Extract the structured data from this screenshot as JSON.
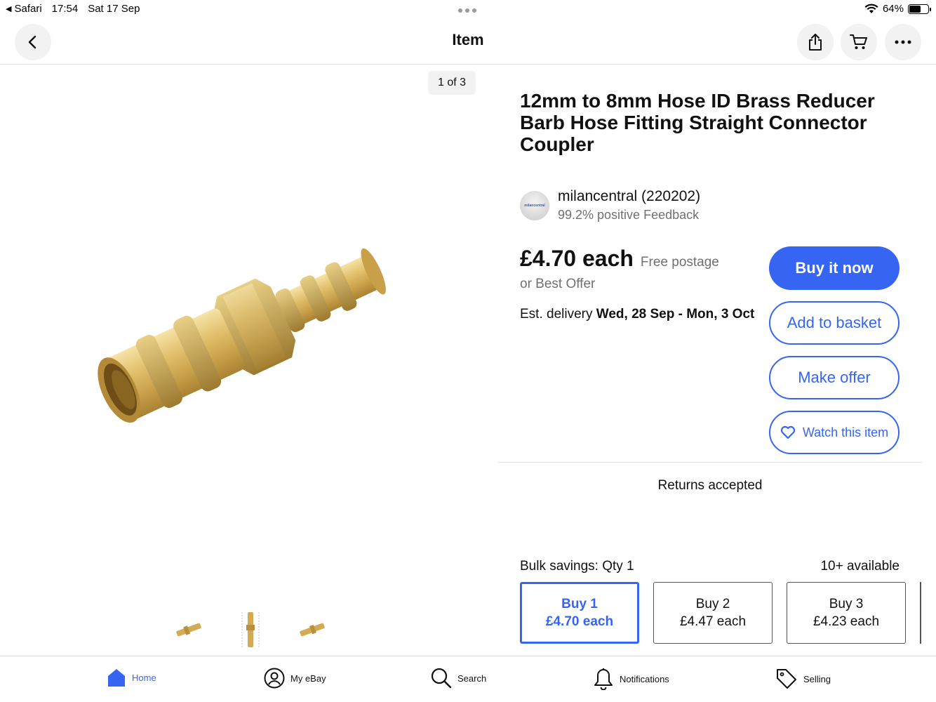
{
  "status_bar": {
    "back_app": "Safari",
    "time": "17:54",
    "date": "Sat 17 Sep",
    "battery": "64%",
    "battery_level": 0.64
  },
  "navbar": {
    "title": "Item",
    "back_icon": "chevron-left-icon",
    "share_icon": "share-icon",
    "cart_icon": "cart-icon",
    "more_icon": "more-horizontal-icon"
  },
  "gallery": {
    "counter": "1 of 3"
  },
  "product": {
    "title": "12mm to 8mm Hose ID Brass Reducer Barb Hose Fitting Straight Connector Coupler",
    "seller_logo_text": "milancentral",
    "seller_name": "milancentral (220202)",
    "seller_feedback": "99.2% positive Feedback",
    "price": "£4.70 each",
    "postage": "Free postage",
    "best_offer": "or Best Offer",
    "delivery_prefix": "Est. delivery ",
    "delivery_dates": "Wed, 28 Sep - Mon, 3 Oct",
    "returns": "Returns accepted"
  },
  "actions": {
    "buy_now": "Buy it now",
    "add_to_basket": "Add to basket",
    "make_offer": "Make offer",
    "watch": "Watch this item"
  },
  "bulk": {
    "label": "Bulk savings: Qty 1",
    "available": "10+ available",
    "tiers": [
      {
        "qty": "Buy 1",
        "price": "£4.70 each"
      },
      {
        "qty": "Buy 2",
        "price": "£4.47 each"
      },
      {
        "qty": "Buy 3",
        "price": "£4.23 each"
      }
    ]
  },
  "tabbar": {
    "items": [
      {
        "label": "Home"
      },
      {
        "label": "My eBay"
      },
      {
        "label": "Search"
      },
      {
        "label": "Notifications"
      },
      {
        "label": "Selling"
      }
    ]
  },
  "colors": {
    "accent": "#3665f3",
    "brass": "#d9b25a"
  }
}
